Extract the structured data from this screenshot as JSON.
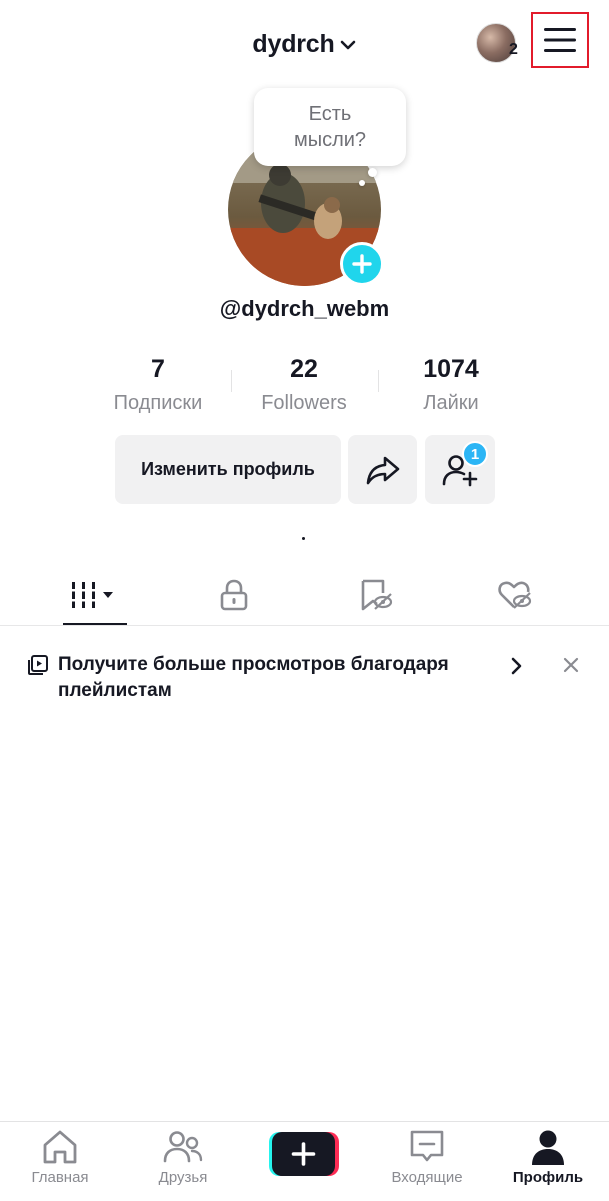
{
  "header": {
    "username": "dydrch",
    "account_count": "2"
  },
  "bubble": {
    "text": "Есть мысли?"
  },
  "profile": {
    "handle": "@dydrch_webm"
  },
  "stats": [
    {
      "value": "7",
      "label": "Подписки"
    },
    {
      "value": "22",
      "label": "Followers"
    },
    {
      "value": "1074",
      "label": "Лайки"
    }
  ],
  "actions": {
    "edit_label": "Изменить профиль",
    "add_friends_badge": "1"
  },
  "playlist_banner": {
    "text": "Получите больше просмотров благодаря плейлистам"
  },
  "bottom_nav": [
    {
      "label": "Главная",
      "icon": "home-icon"
    },
    {
      "label": "Друзья",
      "icon": "friends-icon"
    },
    {
      "label": "",
      "icon": "create-icon"
    },
    {
      "label": "Входящие",
      "icon": "inbox-icon"
    },
    {
      "label": "Профиль",
      "icon": "profile-icon"
    }
  ],
  "colors": {
    "accent": "#20d5ec",
    "badge": "#2bb5f5",
    "highlight_border": "#e21b2b",
    "text": "#161823",
    "muted": "#8a8b91"
  }
}
